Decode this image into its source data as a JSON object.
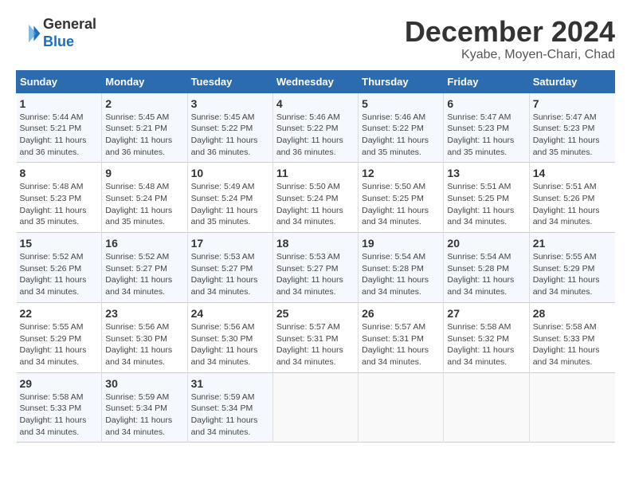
{
  "header": {
    "logo_line1": "General",
    "logo_line2": "Blue",
    "month": "December 2024",
    "location": "Kyabe, Moyen-Chari, Chad"
  },
  "days_of_week": [
    "Sunday",
    "Monday",
    "Tuesday",
    "Wednesday",
    "Thursday",
    "Friday",
    "Saturday"
  ],
  "weeks": [
    [
      {
        "day": "1",
        "info": "Sunrise: 5:44 AM\nSunset: 5:21 PM\nDaylight: 11 hours\nand 36 minutes."
      },
      {
        "day": "2",
        "info": "Sunrise: 5:45 AM\nSunset: 5:21 PM\nDaylight: 11 hours\nand 36 minutes."
      },
      {
        "day": "3",
        "info": "Sunrise: 5:45 AM\nSunset: 5:22 PM\nDaylight: 11 hours\nand 36 minutes."
      },
      {
        "day": "4",
        "info": "Sunrise: 5:46 AM\nSunset: 5:22 PM\nDaylight: 11 hours\nand 36 minutes."
      },
      {
        "day": "5",
        "info": "Sunrise: 5:46 AM\nSunset: 5:22 PM\nDaylight: 11 hours\nand 35 minutes."
      },
      {
        "day": "6",
        "info": "Sunrise: 5:47 AM\nSunset: 5:23 PM\nDaylight: 11 hours\nand 35 minutes."
      },
      {
        "day": "7",
        "info": "Sunrise: 5:47 AM\nSunset: 5:23 PM\nDaylight: 11 hours\nand 35 minutes."
      }
    ],
    [
      {
        "day": "8",
        "info": "Sunrise: 5:48 AM\nSunset: 5:23 PM\nDaylight: 11 hours\nand 35 minutes."
      },
      {
        "day": "9",
        "info": "Sunrise: 5:48 AM\nSunset: 5:24 PM\nDaylight: 11 hours\nand 35 minutes."
      },
      {
        "day": "10",
        "info": "Sunrise: 5:49 AM\nSunset: 5:24 PM\nDaylight: 11 hours\nand 35 minutes."
      },
      {
        "day": "11",
        "info": "Sunrise: 5:50 AM\nSunset: 5:24 PM\nDaylight: 11 hours\nand 34 minutes."
      },
      {
        "day": "12",
        "info": "Sunrise: 5:50 AM\nSunset: 5:25 PM\nDaylight: 11 hours\nand 34 minutes."
      },
      {
        "day": "13",
        "info": "Sunrise: 5:51 AM\nSunset: 5:25 PM\nDaylight: 11 hours\nand 34 minutes."
      },
      {
        "day": "14",
        "info": "Sunrise: 5:51 AM\nSunset: 5:26 PM\nDaylight: 11 hours\nand 34 minutes."
      }
    ],
    [
      {
        "day": "15",
        "info": "Sunrise: 5:52 AM\nSunset: 5:26 PM\nDaylight: 11 hours\nand 34 minutes."
      },
      {
        "day": "16",
        "info": "Sunrise: 5:52 AM\nSunset: 5:27 PM\nDaylight: 11 hours\nand 34 minutes."
      },
      {
        "day": "17",
        "info": "Sunrise: 5:53 AM\nSunset: 5:27 PM\nDaylight: 11 hours\nand 34 minutes."
      },
      {
        "day": "18",
        "info": "Sunrise: 5:53 AM\nSunset: 5:27 PM\nDaylight: 11 hours\nand 34 minutes."
      },
      {
        "day": "19",
        "info": "Sunrise: 5:54 AM\nSunset: 5:28 PM\nDaylight: 11 hours\nand 34 minutes."
      },
      {
        "day": "20",
        "info": "Sunrise: 5:54 AM\nSunset: 5:28 PM\nDaylight: 11 hours\nand 34 minutes."
      },
      {
        "day": "21",
        "info": "Sunrise: 5:55 AM\nSunset: 5:29 PM\nDaylight: 11 hours\nand 34 minutes."
      }
    ],
    [
      {
        "day": "22",
        "info": "Sunrise: 5:55 AM\nSunset: 5:29 PM\nDaylight: 11 hours\nand 34 minutes."
      },
      {
        "day": "23",
        "info": "Sunrise: 5:56 AM\nSunset: 5:30 PM\nDaylight: 11 hours\nand 34 minutes."
      },
      {
        "day": "24",
        "info": "Sunrise: 5:56 AM\nSunset: 5:30 PM\nDaylight: 11 hours\nand 34 minutes."
      },
      {
        "day": "25",
        "info": "Sunrise: 5:57 AM\nSunset: 5:31 PM\nDaylight: 11 hours\nand 34 minutes."
      },
      {
        "day": "26",
        "info": "Sunrise: 5:57 AM\nSunset: 5:31 PM\nDaylight: 11 hours\nand 34 minutes."
      },
      {
        "day": "27",
        "info": "Sunrise: 5:58 AM\nSunset: 5:32 PM\nDaylight: 11 hours\nand 34 minutes."
      },
      {
        "day": "28",
        "info": "Sunrise: 5:58 AM\nSunset: 5:33 PM\nDaylight: 11 hours\nand 34 minutes."
      }
    ],
    [
      {
        "day": "29",
        "info": "Sunrise: 5:58 AM\nSunset: 5:33 PM\nDaylight: 11 hours\nand 34 minutes."
      },
      {
        "day": "30",
        "info": "Sunrise: 5:59 AM\nSunset: 5:34 PM\nDaylight: 11 hours\nand 34 minutes."
      },
      {
        "day": "31",
        "info": "Sunrise: 5:59 AM\nSunset: 5:34 PM\nDaylight: 11 hours\nand 34 minutes."
      },
      null,
      null,
      null,
      null
    ]
  ]
}
